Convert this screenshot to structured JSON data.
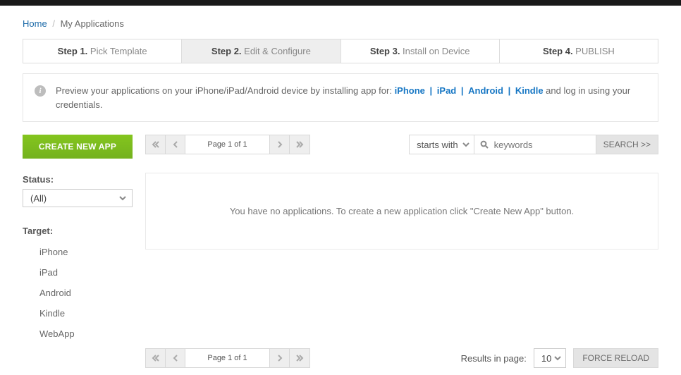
{
  "breadcrumbs": {
    "home": "Home",
    "current": "My Applications"
  },
  "steps": [
    {
      "bold": "Step 1.",
      "label": " Pick Template",
      "active": false
    },
    {
      "bold": "Step 2.",
      "label": " Edit & Configure",
      "active": true
    },
    {
      "bold": "Step 3.",
      "label": " Install on Device",
      "active": false
    },
    {
      "bold": "Step 4.",
      "label": " PUBLISH",
      "active": false
    }
  ],
  "info": {
    "prefix": "Preview your applications on your iPhone/iPad/Android device by installing app for: ",
    "links": [
      "iPhone",
      "iPad",
      "Android",
      "Kindle"
    ],
    "suffix": " and log in using your credentials."
  },
  "sidebar": {
    "create_label": "CREATE NEW APP",
    "status_label": "Status:",
    "status_value": "(All)",
    "target_label": "Target:",
    "targets": [
      "iPhone",
      "iPad",
      "Android",
      "Kindle",
      "WebApp"
    ]
  },
  "pager": {
    "label": "Page 1 of 1"
  },
  "search": {
    "mode": "starts with",
    "placeholder": "keywords",
    "button": "SEARCH >>"
  },
  "empty_message": "You have no applications. To create a new application click \"Create New App\" button.",
  "footer": {
    "results_label": "Results in page:",
    "page_size": "10",
    "force_reload": "FORCE RELOAD"
  }
}
